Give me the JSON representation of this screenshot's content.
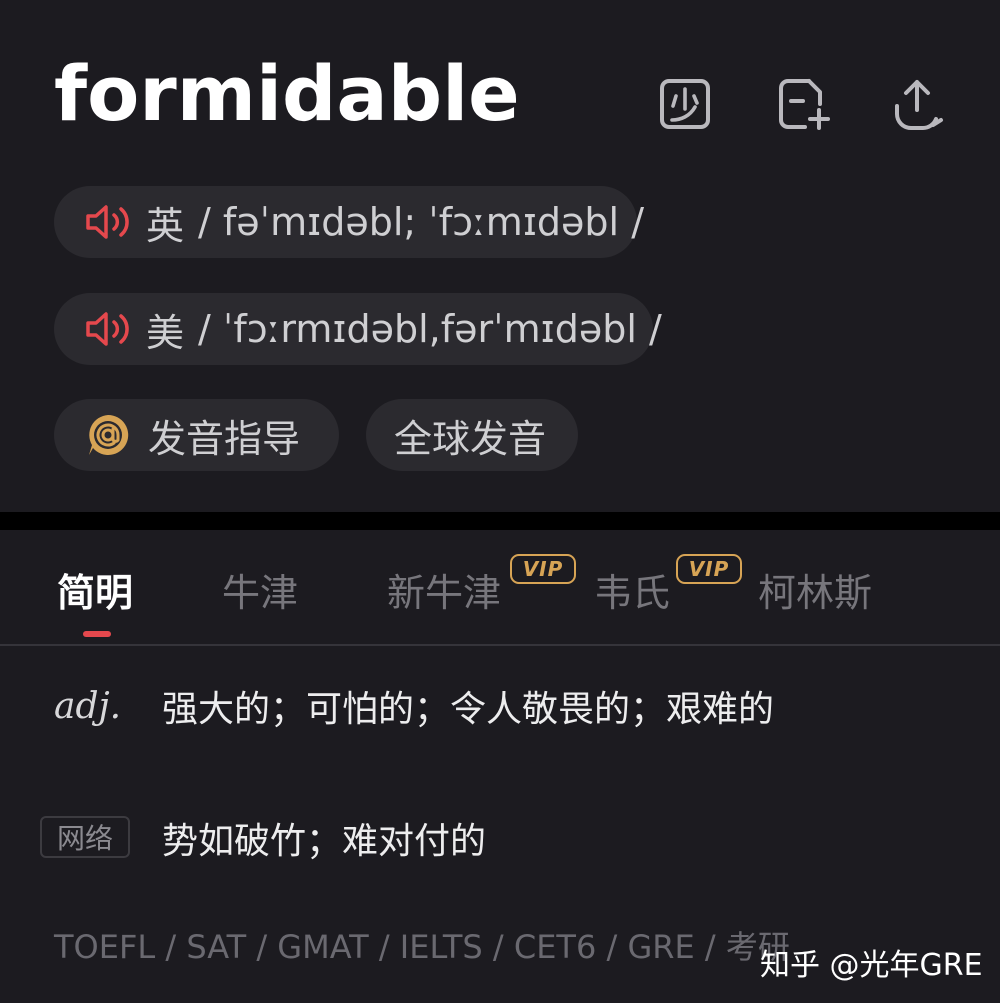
{
  "word": "formidable",
  "toolbar": {
    "shao_icon": "shao-character-icon",
    "add_icon": "add-to-wordbook-icon",
    "share_icon": "share-icon"
  },
  "pronunciations": [
    {
      "accent": "英",
      "ipa": "/ fəˈmɪdəbl; ˈfɔːmɪdəbl /",
      "icon": "speaker-icon"
    },
    {
      "accent": "美",
      "ipa": "/ ˈfɔːrmɪdəbl,fərˈmɪdəbl /",
      "icon": "speaker-icon"
    }
  ],
  "actions": {
    "guide_label": "发音指导",
    "global_label": "全球发音"
  },
  "tabs": [
    {
      "label": "简明",
      "active": true,
      "vip": false
    },
    {
      "label": "牛津",
      "active": false,
      "vip": false
    },
    {
      "label": "新牛津",
      "active": false,
      "vip": true
    },
    {
      "label": "韦氏",
      "active": false,
      "vip": true
    },
    {
      "label": "柯林斯",
      "active": false,
      "vip": false
    }
  ],
  "vip_label": "VIP",
  "definitions": {
    "pos": "adj.",
    "meaning": "强大的；可怕的；令人敬畏的；艰难的",
    "net_tag": "网络",
    "net_meaning": "势如破竹；难对付的"
  },
  "exam_tags": "TOEFL / SAT / GMAT / IELTS / CET6 / GRE / 考研",
  "watermark": "知乎 @光年GRE",
  "colors": {
    "background": "#1c1b20",
    "pill": "#2b2a2f",
    "accent_red": "#e5484d",
    "vip_gold": "#d7a455"
  }
}
